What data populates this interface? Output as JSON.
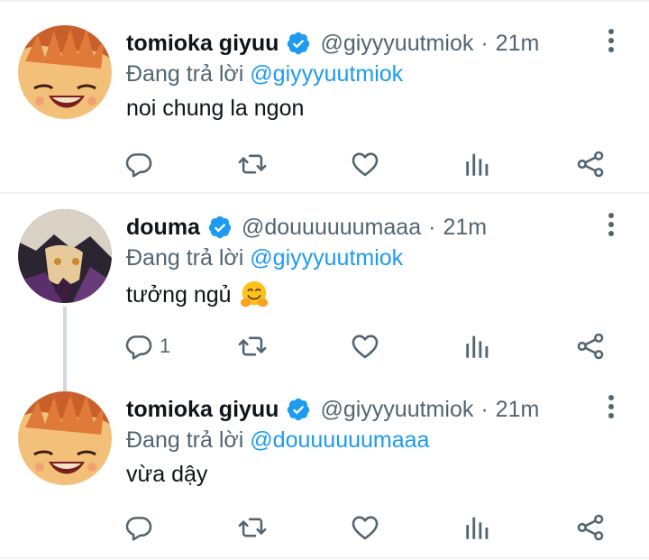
{
  "colors": {
    "accent": "#1d9bf0",
    "muted": "#536471",
    "text": "#0f1419",
    "divider": "#eff3f4"
  },
  "tweets": [
    {
      "name": "tomioka giyuu",
      "handle": "@giyyyuutmiok",
      "dot": "·",
      "time": "21m",
      "reply_prefix": "Đang trả lời",
      "reply_to": "@giyyyuutmiok",
      "text": "noi chung la ngon",
      "avatar": "smiling-anime-avatar",
      "reply_count": ""
    },
    {
      "name": "douma",
      "handle": "@douuuuuumaaa",
      "dot": "·",
      "time": "21m",
      "reply_prefix": "Đang trả lời",
      "reply_to": "@giyyyuutmiok",
      "text": "tưởng ngủ",
      "emoji": "hugging-face-emoji",
      "avatar": "dark-anime-avatar",
      "reply_count": "1"
    },
    {
      "name": "tomioka giyuu",
      "handle": "@giyyyuutmiok",
      "dot": "·",
      "time": "21m",
      "reply_prefix": "Đang trả lời",
      "reply_to": "@douuuuuumaaa",
      "text": "vừa dậy",
      "avatar": "smiling-anime-avatar",
      "reply_count": ""
    }
  ],
  "action_icons": [
    "reply-icon",
    "retweet-icon",
    "like-icon",
    "analytics-icon",
    "share-icon"
  ]
}
